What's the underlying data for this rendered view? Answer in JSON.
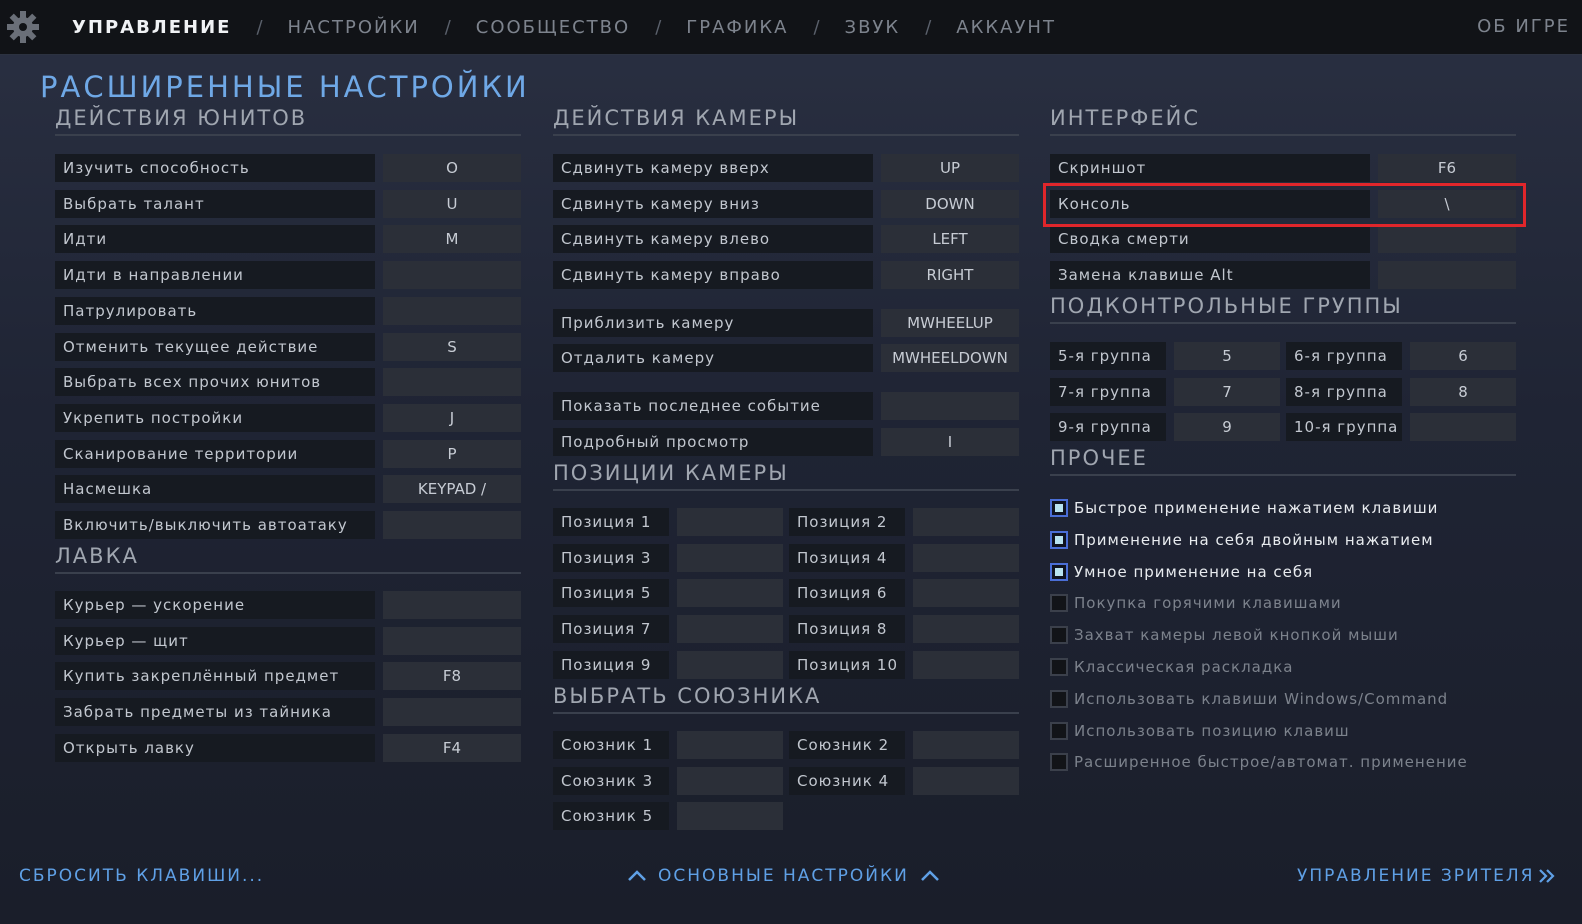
{
  "nav": {
    "tabs": [
      "УПРАВЛЕНИЕ",
      "НАСТРОЙКИ",
      "СООБЩЕСТВО",
      "ГРАФИКА",
      "ЗВУК",
      "АККАУНТ"
    ],
    "separator": "/",
    "about": "ОБ ИГРЕ"
  },
  "page_title": "РАСШИРЕННЫЕ НАСТРОЙКИ",
  "unit_actions": {
    "title": "ДЕЙСТВИЯ ЮНИТОВ",
    "rows": [
      {
        "label": "Изучить способность",
        "key": "O"
      },
      {
        "label": "Выбрать талант",
        "key": "U"
      },
      {
        "label": "Идти",
        "key": "M"
      },
      {
        "label": "Идти в направлении",
        "key": ""
      },
      {
        "label": "Патрулировать",
        "key": ""
      },
      {
        "label": "Отменить текущее действие",
        "key": "S"
      },
      {
        "label": "Выбрать всех прочих юнитов",
        "key": ""
      },
      {
        "label": "Укрепить постройки",
        "key": "J"
      },
      {
        "label": "Сканирование территории",
        "key": "P"
      },
      {
        "label": "Насмешка",
        "key": "KEYPAD /"
      },
      {
        "label": "Включить/выключить автоатаку",
        "key": ""
      }
    ]
  },
  "shop": {
    "title": "ЛАВКА",
    "rows": [
      {
        "label": "Курьер — ускорение",
        "key": ""
      },
      {
        "label": "Курьер — щит",
        "key": ""
      },
      {
        "label": "Купить закреплённый предмет",
        "key": "F8"
      },
      {
        "label": "Забрать предметы из тайника",
        "key": ""
      },
      {
        "label": "Открыть лавку",
        "key": "F4"
      }
    ]
  },
  "camera_actions": {
    "title": "ДЕЙСТВИЯ КАМЕРЫ",
    "rows": [
      {
        "label": "Сдвинуть камеру вверх",
        "key": "UP"
      },
      {
        "label": "Сдвинуть камеру вниз",
        "key": "DOWN"
      },
      {
        "label": "Сдвинуть камеру влево",
        "key": "LEFT"
      },
      {
        "label": "Сдвинуть камеру вправо",
        "key": "RIGHT"
      },
      {
        "label": "Приблизить камеру",
        "key": "MWHEELUP"
      },
      {
        "label": "Отдалить камеру",
        "key": "MWHEELDOWN"
      },
      {
        "label": "Показать последнее событие",
        "key": ""
      },
      {
        "label": "Подробный просмотр",
        "key": "I"
      }
    ]
  },
  "camera_positions": {
    "title": "ПОЗИЦИИ КАМЕРЫ",
    "items": [
      {
        "label": "Позиция 1",
        "key": ""
      },
      {
        "label": "Позиция 2",
        "key": ""
      },
      {
        "label": "Позиция 3",
        "key": ""
      },
      {
        "label": "Позиция 4",
        "key": ""
      },
      {
        "label": "Позиция 5",
        "key": ""
      },
      {
        "label": "Позиция 6",
        "key": ""
      },
      {
        "label": "Позиция 7",
        "key": ""
      },
      {
        "label": "Позиция 8",
        "key": ""
      },
      {
        "label": "Позиция 9",
        "key": ""
      },
      {
        "label": "Позиция 10",
        "key": ""
      }
    ]
  },
  "select_ally": {
    "title": "ВЫБРАТЬ СОЮЗНИКА",
    "items": [
      {
        "label": "Союзник 1",
        "key": ""
      },
      {
        "label": "Союзник 2",
        "key": ""
      },
      {
        "label": "Союзник 3",
        "key": ""
      },
      {
        "label": "Союзник 4",
        "key": ""
      },
      {
        "label": "Союзник 5",
        "key": ""
      }
    ]
  },
  "interface": {
    "title": "ИНТЕРФЕЙС",
    "rows": [
      {
        "label": "Скриншот",
        "key": "F6"
      },
      {
        "label": "Консоль",
        "key": "\\"
      },
      {
        "label": "Сводка смерти",
        "key": ""
      },
      {
        "label": "Замена клавише Alt",
        "key": ""
      }
    ]
  },
  "control_groups": {
    "title": "ПОДКОНТРОЛЬНЫЕ ГРУППЫ",
    "items": [
      {
        "label": "5-я группа",
        "key": "5"
      },
      {
        "label": "6-я группа",
        "key": "6"
      },
      {
        "label": "7-я группа",
        "key": "7"
      },
      {
        "label": "8-я группа",
        "key": "8"
      },
      {
        "label": "9-я группа",
        "key": "9"
      },
      {
        "label": "10-я группа",
        "key": ""
      }
    ]
  },
  "other": {
    "title": "ПРОЧЕЕ",
    "options": [
      {
        "label": "Быстрое применение нажатием клавиши",
        "checked": true
      },
      {
        "label": "Применение на себя двойным нажатием",
        "checked": true
      },
      {
        "label": "Умное применение на себя",
        "checked": true
      },
      {
        "label": "Покупка горячими клавишами",
        "checked": false
      },
      {
        "label": "Захват камеры левой кнопкой мыши",
        "checked": false
      },
      {
        "label": "Классическая раскладка",
        "checked": false
      },
      {
        "label": "Использовать клавиши Windows/Command",
        "checked": false
      },
      {
        "label": "Использовать позицию клавиш",
        "checked": false
      },
      {
        "label": "Расширенное быстрое/автомат. применение",
        "checked": false
      }
    ]
  },
  "footer": {
    "reset": "СБРОСИТЬ КЛАВИШИ...",
    "basic": "ОСНОВНЫЕ НАСТРОЙКИ",
    "spectator": "УПРАВЛЕНИЕ ЗРИТЕЛЯ"
  },
  "colors": {
    "accent": "#6fa8e6",
    "highlight": "#e0262b",
    "checkbox_on": "#b8e3f0"
  }
}
